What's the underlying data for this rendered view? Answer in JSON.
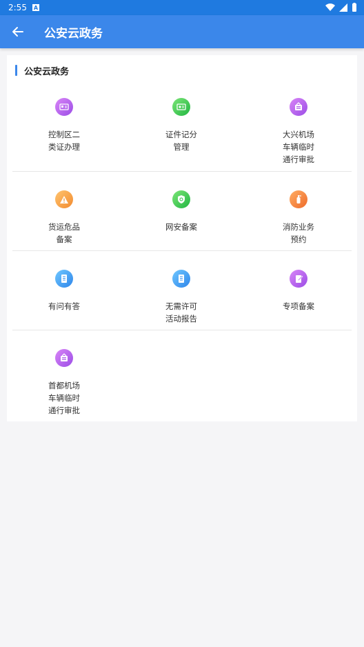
{
  "status": {
    "time": "2:55",
    "badge": "A"
  },
  "header": {
    "title": "公安云政务"
  },
  "section": {
    "title": "公安云政务"
  },
  "items": [
    {
      "lines": [
        "控制区二",
        "类证办理"
      ],
      "icon": "id-card-icon"
    },
    {
      "lines": [
        "证件记分",
        "管理"
      ],
      "icon": "certificate-icon"
    },
    {
      "lines": [
        "大兴机场",
        "车辆临时",
        "通行审批"
      ],
      "icon": "vehicle-pass-icon"
    },
    {
      "lines": [
        "货运危品",
        "备案"
      ],
      "icon": "warning-icon"
    },
    {
      "lines": [
        "网安备案"
      ],
      "icon": "shield-icon"
    },
    {
      "lines": [
        "消防业务",
        "预约"
      ],
      "icon": "fire-extinguisher-icon"
    },
    {
      "lines": [
        "有问有答"
      ],
      "icon": "qa-book-icon"
    },
    {
      "lines": [
        "无需许可",
        "活动报告"
      ],
      "icon": "report-book-icon"
    },
    {
      "lines": [
        "专项备案"
      ],
      "icon": "edit-note-icon"
    },
    {
      "lines": [
        "首都机场",
        "车辆临时",
        "通行审批"
      ],
      "icon": "vehicle-pass-icon"
    }
  ]
}
